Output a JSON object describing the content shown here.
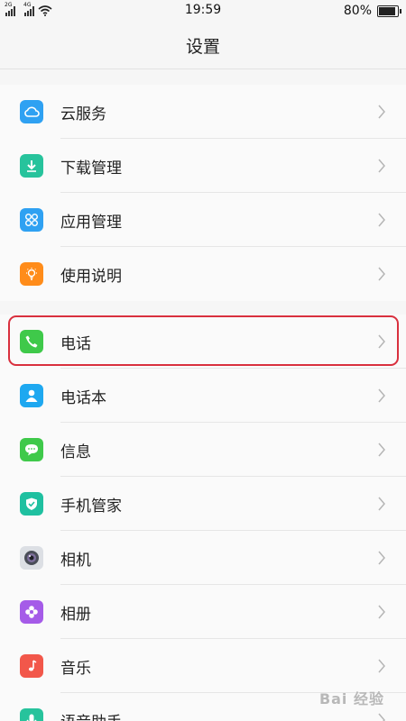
{
  "status_bar": {
    "net_left": "2G",
    "net_right": "4G",
    "time": "19:59",
    "battery_text": "80%",
    "battery_level": 0.8
  },
  "header": {
    "title": "设置"
  },
  "group1": [
    {
      "label": "云服务",
      "icon": "cloud-icon",
      "color": "#2fa1f2"
    },
    {
      "label": "下载管理",
      "icon": "download-icon",
      "color": "#27c39c"
    },
    {
      "label": "应用管理",
      "icon": "apps-icon",
      "color": "#2fa1f2"
    },
    {
      "label": "使用说明",
      "icon": "bulb-icon",
      "color": "#ff8c1a"
    }
  ],
  "group2": [
    {
      "label": "电话",
      "icon": "phone-icon",
      "color": "#3fc94a"
    },
    {
      "label": "电话本",
      "icon": "contacts-icon",
      "color": "#1ea8f0"
    },
    {
      "label": "信息",
      "icon": "message-icon",
      "color": "#3fc94a"
    },
    {
      "label": "手机管家",
      "icon": "shield-icon",
      "color": "#1fc0a0"
    },
    {
      "label": "相机",
      "icon": "camera-icon",
      "color": "#9ea4ae"
    },
    {
      "label": "相册",
      "icon": "flower-icon",
      "color": "#a55be8"
    },
    {
      "label": "音乐",
      "icon": "music-icon",
      "color": "#f2574a"
    },
    {
      "label": "语音助手",
      "icon": "voice-icon",
      "color": "#27c39c"
    }
  ],
  "watermark": "Bai 经验"
}
